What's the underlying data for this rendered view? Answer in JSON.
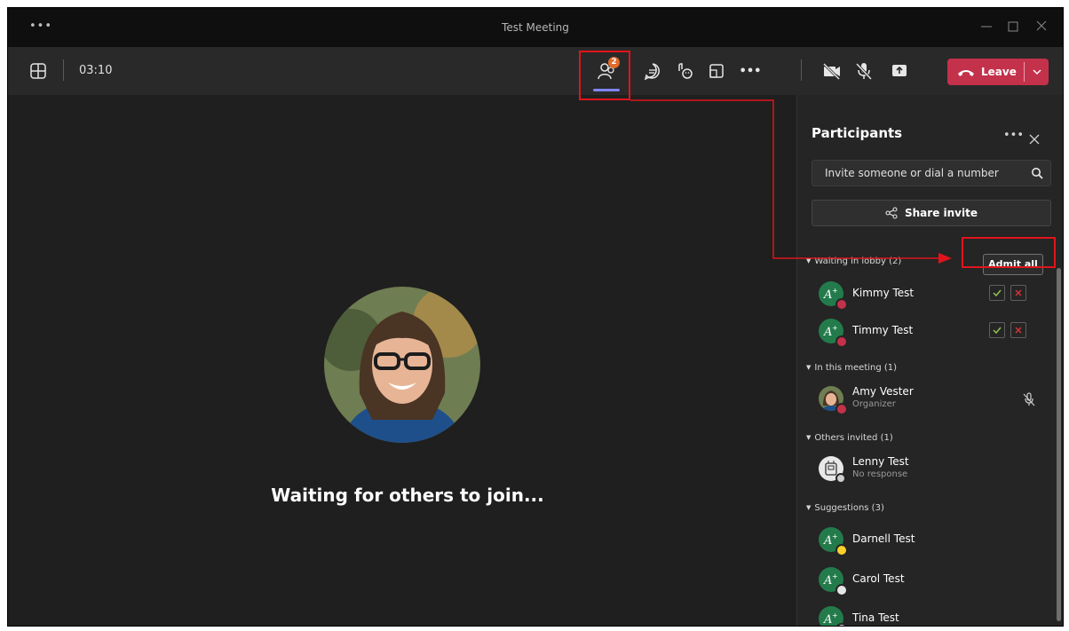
{
  "window": {
    "title": "Test Meeting",
    "menu": "•••"
  },
  "toolbar": {
    "timer": "03:10",
    "participants_badge": "2",
    "more": "•••",
    "leave_label": "Leave"
  },
  "stage": {
    "waiting_text": "Waiting for others to join..."
  },
  "panel": {
    "title": "Participants",
    "more": "•••",
    "invite_placeholder": "Invite someone or dial a number",
    "share_label": "Share invite",
    "lobby": {
      "label": "Waiting in lobby (2)",
      "admit_all_label": "Admit all",
      "people": [
        {
          "name": "Kimmy Test"
        },
        {
          "name": "Timmy Test"
        }
      ]
    },
    "meeting": {
      "label": "In this meeting (1)",
      "people": [
        {
          "name": "Amy Vester",
          "role": "Organizer"
        }
      ]
    },
    "invited": {
      "label": "Others invited (1)",
      "people": [
        {
          "name": "Lenny Test",
          "role": "No response"
        }
      ]
    },
    "suggestions": {
      "label": "Suggestions (3)",
      "people": [
        {
          "name": "Darnell Test"
        },
        {
          "name": "Carol Test"
        },
        {
          "name": "Tina Test"
        }
      ]
    }
  },
  "colors": {
    "leave": "#c4314b",
    "highlight": "#e0141b",
    "avatar_green": "#237b4b",
    "accent": "#7f85f5"
  }
}
